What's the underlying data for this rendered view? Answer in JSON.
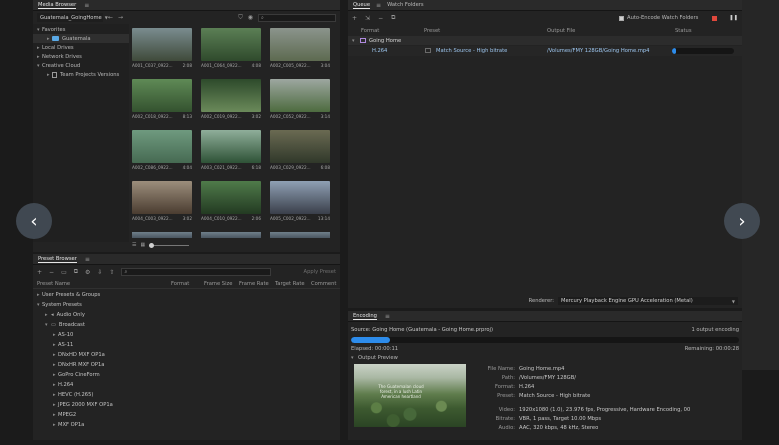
{
  "media_browser": {
    "title": "Media Browser",
    "location": "Guatemala_GoingHome",
    "tree": [
      {
        "label": "Favorites",
        "level": 0
      },
      {
        "label": "Guatemala",
        "level": 1
      },
      {
        "label": "Local Drives",
        "level": 0
      },
      {
        "label": "Network Drives",
        "level": 0
      },
      {
        "label": "Creative Cloud",
        "level": 0
      },
      {
        "label": "Team Projects Versions",
        "level": 1
      }
    ],
    "clips": [
      {
        "name": "A001_C037_0922...",
        "dur": "2:08",
        "c1": "#7a8c8f",
        "c2": "#3f4a3a"
      },
      {
        "name": "A001_C064_0922...",
        "dur": "4:08",
        "c1": "#5b7f55",
        "c2": "#2f4a2c"
      },
      {
        "name": "A002_C005_0922...",
        "dur": "3:04",
        "c1": "#8b948c",
        "c2": "#5d6a50"
      },
      {
        "name": "A002_C018_0922...",
        "dur": "8:13",
        "c1": "#5f8a56",
        "c2": "#34522f"
      },
      {
        "name": "A002_C019_0922...",
        "dur": "3:02",
        "c1": "#2d4a2b",
        "c2": "#6b8a5a"
      },
      {
        "name": "A002_C052_0922...",
        "dur": "3:14",
        "c1": "#9da7a0",
        "c2": "#4d6b3f"
      },
      {
        "name": "A002_C086_0922...",
        "dur": "4:04",
        "c1": "#6f9a7f",
        "c2": "#466a52"
      },
      {
        "name": "A003_C021_0922...",
        "dur": "6:18",
        "c1": "#8fae9a",
        "c2": "#2e5236"
      },
      {
        "name": "A003_C029_0922...",
        "dur": "6:08",
        "c1": "#6a6a52",
        "c2": "#30382a"
      },
      {
        "name": "A004_C003_0922...",
        "dur": "3:02",
        "c1": "#9c8e7c",
        "c2": "#4a3c30"
      },
      {
        "name": "A004_C010_0922...",
        "dur": "2:06",
        "c1": "#4f7b4a",
        "c2": "#233a22"
      },
      {
        "name": "A005_C002_0922...",
        "dur": "13:14",
        "c1": "#8fa0b4",
        "c2": "#3a3f4a"
      }
    ]
  },
  "preset_browser": {
    "title": "Preset Browser",
    "apply_label": "Apply Preset",
    "columns": [
      "Preset Name",
      "Format",
      "Frame Size",
      "Frame Rate",
      "Target Rate",
      "Comment"
    ],
    "rows": [
      {
        "label": "User Presets & Groups",
        "level": 0,
        "arrow": "▸",
        "icon": ""
      },
      {
        "label": "System Presets",
        "level": 0,
        "arrow": "▾",
        "icon": ""
      },
      {
        "label": "Audio Only",
        "level": 1,
        "arrow": "▸",
        "icon": "speaker-icon"
      },
      {
        "label": "Broadcast",
        "level": 1,
        "arrow": "▾",
        "icon": "monitor-icon"
      },
      {
        "label": "AS-10",
        "level": 2,
        "arrow": "▸",
        "icon": ""
      },
      {
        "label": "AS-11",
        "level": 2,
        "arrow": "▸",
        "icon": ""
      },
      {
        "label": "DNxHD MXF OP1a",
        "level": 2,
        "arrow": "▸",
        "icon": ""
      },
      {
        "label": "DNxHR MXF OP1a",
        "level": 2,
        "arrow": "▸",
        "icon": ""
      },
      {
        "label": "GoPro CineForm",
        "level": 2,
        "arrow": "▸",
        "icon": ""
      },
      {
        "label": "H.264",
        "level": 2,
        "arrow": "▸",
        "icon": ""
      },
      {
        "label": "HEVC (H.265)",
        "level": 2,
        "arrow": "▸",
        "icon": ""
      },
      {
        "label": "JPEG 2000 MXF OP1a",
        "level": 2,
        "arrow": "▸",
        "icon": ""
      },
      {
        "label": "MPEG2",
        "level": 2,
        "arrow": "▸",
        "icon": ""
      },
      {
        "label": "MXF OP1a",
        "level": 2,
        "arrow": "▸",
        "icon": ""
      }
    ]
  },
  "queue": {
    "tabs": [
      "Queue",
      "Watch Folders"
    ],
    "auto_encode_label": "Auto-Encode Watch Folders",
    "columns": [
      "Format",
      "Preset",
      "Output File",
      "Status"
    ],
    "group_name": "Going Home",
    "item": {
      "format": "H.264",
      "preset": "Match Source - High bitrate",
      "output": "/Volumes/FMY 128GB/Going Home.mp4",
      "progress": 0.06
    },
    "renderer_label": "Renderer:",
    "renderer_value": "Mercury Playback Engine GPU Acceleration (Metal)"
  },
  "encoding": {
    "title": "Encoding",
    "source": "Source: Going Home (Guatemala - Going Home.prproj)",
    "output_count": "1 output encoding",
    "progress": 0.1,
    "elapsed": "Elapsed: 00:00:11",
    "remaining": "Remaining: 00:00:28",
    "output_preview_label": "Output Preview",
    "preview_caption": "The Guatemalan cloud forest, in a lush Latin American heartland",
    "meta": [
      {
        "k": "File Name:",
        "v": "Going Home.mp4"
      },
      {
        "k": "Path:",
        "v": "/Volumes/FMY 128GB/"
      },
      {
        "k": "Format:",
        "v": "H.264"
      },
      {
        "k": "Preset:",
        "v": "Match Source - High bitrate"
      },
      {
        "k": "Video:",
        "v": "1920x1080 (1.0), 23.976 fps, Progressive, Hardware Encoding, 00"
      },
      {
        "k": "Bitrate:",
        "v": "VBR, 1 pass, Target 10.00 Mbps"
      },
      {
        "k": "Audio:",
        "v": "AAC, 320 kbps, 48 kHz, Stereo"
      }
    ]
  },
  "colors": {
    "accent": "#2d8ceb",
    "panel": "#232323",
    "header": "#2a2a2a",
    "folder": "#5aa9e6",
    "stop": "#e0483c"
  }
}
